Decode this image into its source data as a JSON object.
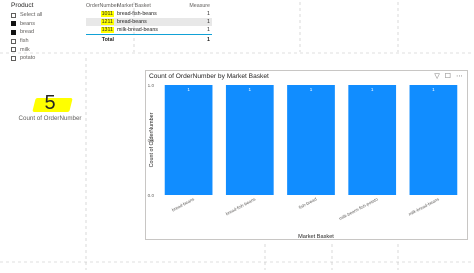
{
  "slicer": {
    "title": "Product",
    "items": [
      {
        "label": "Select all",
        "checked": false
      },
      {
        "label": "beans",
        "checked": true
      },
      {
        "label": "bread",
        "checked": true
      },
      {
        "label": "fish",
        "checked": false
      },
      {
        "label": "milk",
        "checked": false
      },
      {
        "label": "potato",
        "checked": false
      }
    ]
  },
  "table": {
    "headers": [
      "OrderNumber",
      "Market Basket",
      "Measure"
    ],
    "rows": [
      {
        "order": "1011",
        "basket": "bread-fish-beans",
        "measure": "1"
      },
      {
        "order": "1211",
        "basket": "bread-beans",
        "measure": "1"
      },
      {
        "order": "1311",
        "basket": "milk-bread-beans",
        "measure": "1"
      }
    ],
    "total_label": "Total",
    "total_value": "1"
  },
  "card": {
    "value": "5",
    "label": "Count of OrderNumber"
  },
  "chart": {
    "title": "Count of OrderNumber by Market Basket"
  },
  "colors": {
    "bar": "#118dff",
    "highlight": "#ffff00",
    "accent": "#11a1d6"
  },
  "chart_data": {
    "type": "bar",
    "title": "Count of OrderNumber by Market Basket",
    "categories": [
      "bread-beans",
      "bread-fish-beans",
      "fish-bread",
      "milk-beans-fish-potato",
      "milk-bread-beans"
    ],
    "values": [
      1,
      1,
      1,
      1,
      1
    ],
    "data_labels": [
      "1",
      "1",
      "1",
      "1",
      "1"
    ],
    "xlabel": "Market Basket",
    "ylabel": "Count of OrderNumber",
    "ylim": [
      0,
      1
    ],
    "yticks": [
      "0.0",
      "0.5",
      "1.0"
    ],
    "grid": false,
    "legend": "none"
  }
}
